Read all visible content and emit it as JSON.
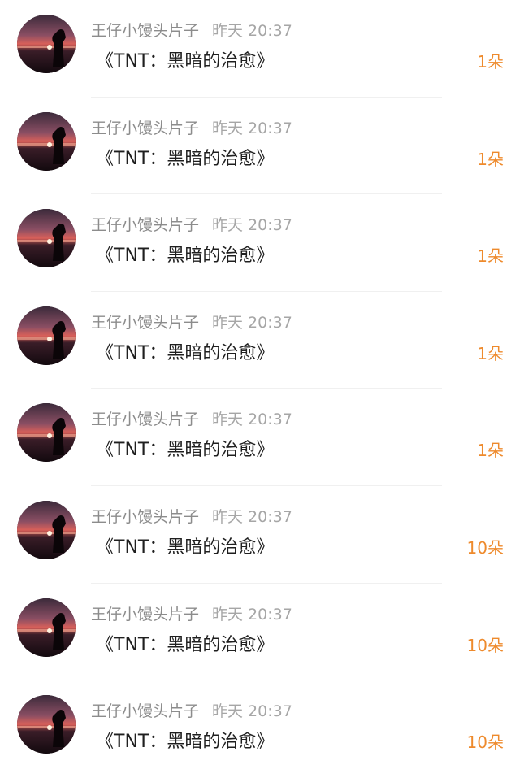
{
  "items": [
    {
      "username": "王仔小馒头片子",
      "time": "昨天 20:37",
      "title": "《TNT：黑暗的治愈》",
      "count": "1朵"
    },
    {
      "username": "王仔小馒头片子",
      "time": "昨天 20:37",
      "title": "《TNT：黑暗的治愈》",
      "count": "1朵"
    },
    {
      "username": "王仔小馒头片子",
      "time": "昨天 20:37",
      "title": "《TNT：黑暗的治愈》",
      "count": "1朵"
    },
    {
      "username": "王仔小馒头片子",
      "time": "昨天 20:37",
      "title": "《TNT：黑暗的治愈》",
      "count": "1朵"
    },
    {
      "username": "王仔小馒头片子",
      "time": "昨天 20:37",
      "title": "《TNT：黑暗的治愈》",
      "count": "1朵"
    },
    {
      "username": "王仔小馒头片子",
      "time": "昨天 20:37",
      "title": "《TNT：黑暗的治愈》",
      "count": "10朵"
    },
    {
      "username": "王仔小馒头片子",
      "time": "昨天 20:37",
      "title": "《TNT：黑暗的治愈》",
      "count": "10朵"
    },
    {
      "username": "王仔小馒头片子",
      "time": "昨天 20:37",
      "title": "《TNT：黑暗的治愈》",
      "count": "10朵"
    }
  ],
  "colors": {
    "count_accent": "#ee8a2c",
    "meta_text": "#8c8c8c",
    "title_text": "#1f1f1f"
  }
}
